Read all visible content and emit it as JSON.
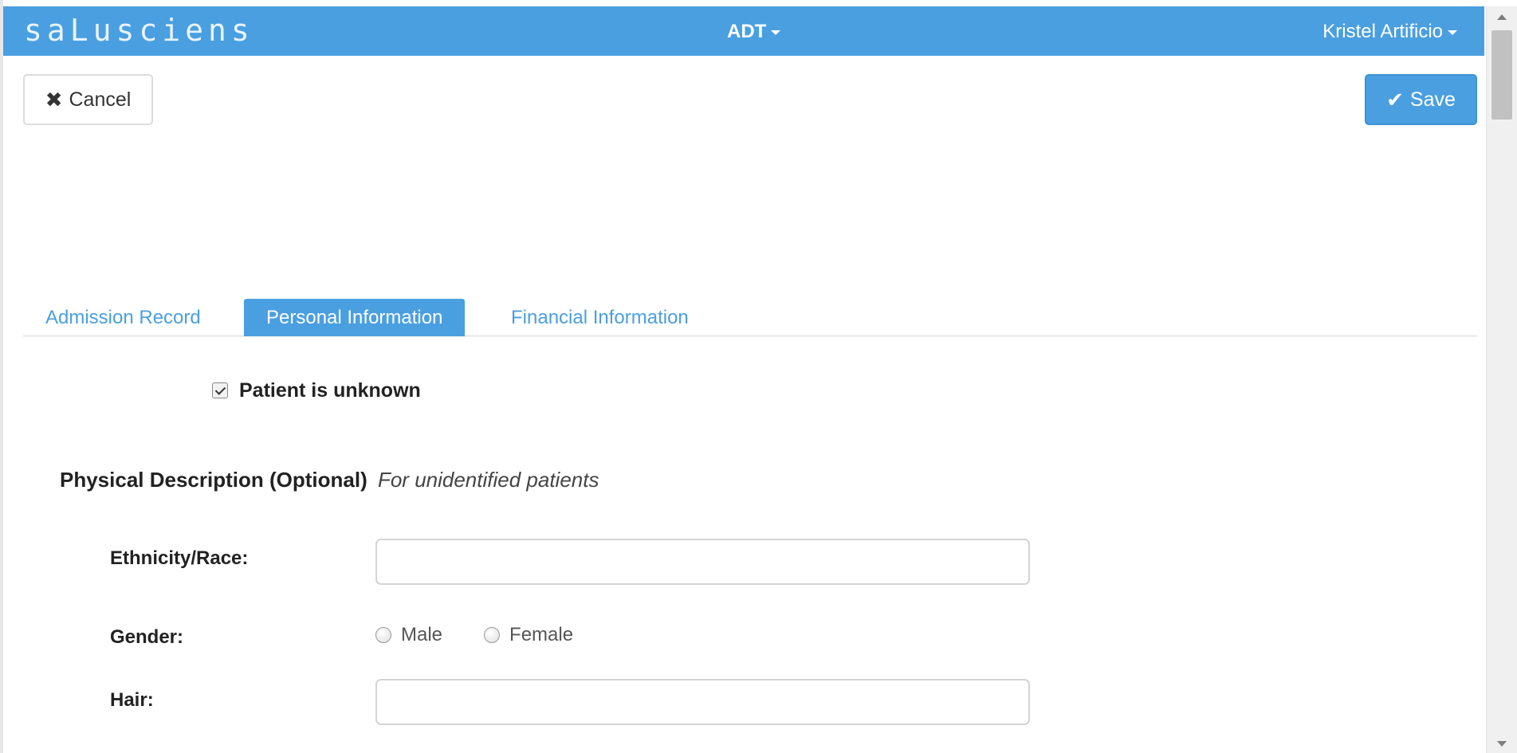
{
  "navbar": {
    "brand": "saLusciens",
    "module": "ADT",
    "user": "Kristel Artificio"
  },
  "toolbar": {
    "cancel_label": "Cancel",
    "save_label": "Save"
  },
  "tabs": [
    {
      "label": "Admission Record",
      "active": false
    },
    {
      "label": "Personal Information",
      "active": true
    },
    {
      "label": "Financial Information",
      "active": false
    }
  ],
  "form": {
    "unknown_checkbox": {
      "label": "Patient is unknown",
      "checked": true
    },
    "section": {
      "title": "Physical Description (Optional)",
      "subtitle": "For unidentified patients"
    },
    "ethnicity": {
      "label": "Ethnicity/Race:",
      "value": ""
    },
    "gender": {
      "label": "Gender:",
      "options": [
        "Male",
        "Female"
      ],
      "selected": null
    },
    "hair": {
      "label": "Hair:",
      "value": ""
    }
  },
  "colors": {
    "primary": "#4a9fe0",
    "text": "#333333"
  },
  "icons": {
    "cancel": "close-icon",
    "save": "check-icon",
    "dropdown": "caret-down-icon"
  }
}
